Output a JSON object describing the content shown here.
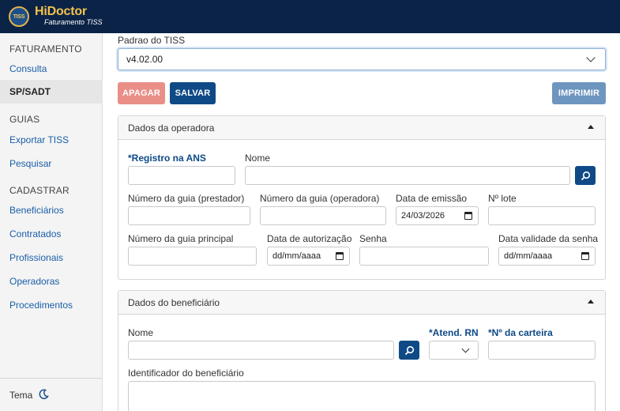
{
  "header": {
    "logo_text": "TISS",
    "brand": "HiDoctor",
    "subtitle": "Faturamento TISS",
    "colors": {
      "bar": "#0b2346",
      "brand": "#f2c24f"
    }
  },
  "sidebar": {
    "faturamento_head": "FATURAMENTO",
    "consulta": "Consulta",
    "sp_sadt": "SP/SADT",
    "guias_head": "GUIAS",
    "exportar_tiss": "Exportar TISS",
    "pesquisar": "Pesquisar",
    "cadastrar_head": "CADASTRAR",
    "beneficiarios": "Beneficiários",
    "contratados": "Contratados",
    "profissionais": "Profissionais",
    "operadoras": "Operadoras",
    "procedimentos": "Procedimentos",
    "tema": "Tema",
    "tema_icon": "moon-icon"
  },
  "padrao": {
    "label": "Padrao do TISS",
    "value": "v4.02.00"
  },
  "actions": {
    "apagar": "APAGAR",
    "salvar": "SALVAR",
    "imprimir": "IMPRIMIR"
  },
  "operadora": {
    "title": "Dados da operadora",
    "registro_ans_label": "*Registro na ANS",
    "nome_label": "Nome",
    "num_guia_prestador_label": "Número da guia (prestador)",
    "num_guia_operadora_label": "Número da guia (operadora)",
    "data_emissao_label": "Data de emissão",
    "data_emissao_value": "24/03/2026",
    "num_lote_label": "Nº lote",
    "num_guia_principal_label": "Número da guia principal",
    "data_autorizacao_label": "Data de autorização",
    "data_autorizacao_placeholder": "dd/mm/aaaa",
    "senha_label": "Senha",
    "data_validade_senha_label": "Data validade da senha",
    "data_validade_senha_placeholder": "dd/mm/aaaa"
  },
  "beneficiario": {
    "title": "Dados do beneficiário",
    "nome_label": "Nome",
    "atend_rn_label": "*Atend. RN",
    "num_carteira_label": "*Nº da carteira",
    "identificador_label": "Identificador do beneficiário"
  }
}
